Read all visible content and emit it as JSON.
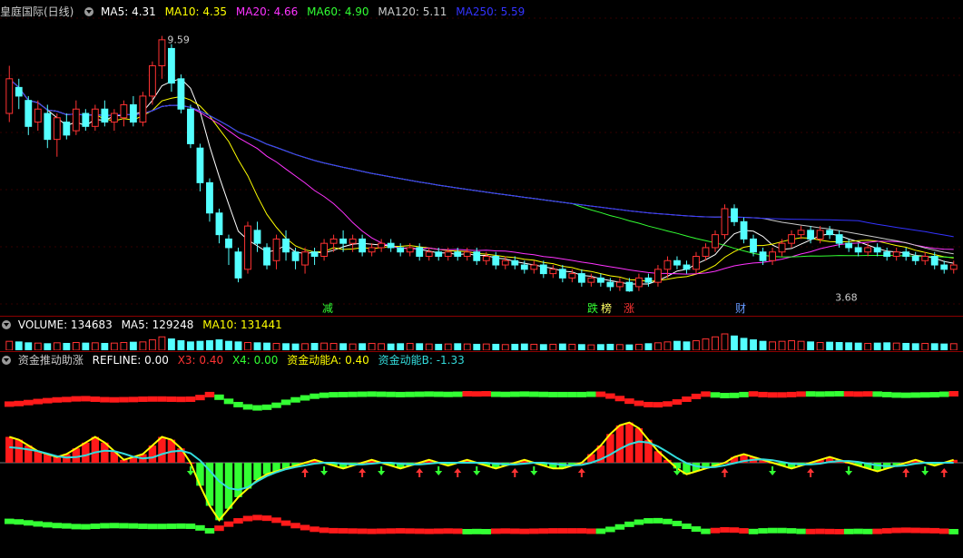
{
  "header": {
    "title": "皇庭国际(日线)",
    "indicators": [
      {
        "label": "MA5: 4.31",
        "color": "#ffffff"
      },
      {
        "label": "MA10: 4.35",
        "color": "#ffff00"
      },
      {
        "label": "MA20: 4.66",
        "color": "#ff33ff"
      },
      {
        "label": "MA60: 4.90",
        "color": "#33ff33"
      },
      {
        "label": "MA120: 5.11",
        "color": "#cccccc"
      },
      {
        "label": "MA250: 5.59",
        "color": "#3333ff"
      }
    ]
  },
  "volume_header": {
    "indicators": [
      {
        "label": "VOLUME: 134683",
        "color": "#ffffff"
      },
      {
        "label": "MA5: 129248",
        "color": "#ffffff"
      },
      {
        "label": "MA10: 131441",
        "color": "#ffff00"
      }
    ]
  },
  "fund_header": {
    "title": "资金推动助涨",
    "indicators": [
      {
        "label": "REFLINE: 0.00",
        "color": "#ffffff"
      },
      {
        "label": "X3: 0.40",
        "color": "#ff3333"
      },
      {
        "label": "X4: 0.00",
        "color": "#33ff33"
      },
      {
        "label": "资金动能A: 0.40",
        "color": "#ffff00"
      },
      {
        "label": "资金动能B: -1.33",
        "color": "#33dddd"
      }
    ]
  },
  "events": [
    {
      "label": "减",
      "color": "#33ff33"
    },
    {
      "label": "跌",
      "color": "#33ff33"
    },
    {
      "label": "榜",
      "color": "#ffff66"
    },
    {
      "label": "涨",
      "color": "#ff3333"
    },
    {
      "label": "财",
      "color": "#6699ff"
    }
  ],
  "chart_data": [
    {
      "type": "candlestick",
      "title": "皇庭国际(日线)",
      "annotations": [
        {
          "text": "9.59",
          "x": 16,
          "y": 9.59
        },
        {
          "text": "3.68",
          "x": 86,
          "y": 3.68
        }
      ],
      "ylim": [
        3.4,
        10.0
      ],
      "candles": [
        [
          0,
          7.8,
          8.6,
          7.6,
          8.9
        ],
        [
          1,
          8.4,
          8.2,
          7.9,
          8.6
        ],
        [
          2,
          8.1,
          7.5,
          7.3,
          8.2
        ],
        [
          3,
          7.6,
          7.9,
          7.4,
          8.1
        ],
        [
          4,
          7.8,
          7.2,
          7.0,
          8.0
        ],
        [
          5,
          7.2,
          7.7,
          6.8,
          7.8
        ],
        [
          6,
          7.6,
          7.3,
          7.2,
          7.8
        ],
        [
          7,
          7.4,
          7.9,
          7.3,
          8.1
        ],
        [
          8,
          7.8,
          7.5,
          7.4,
          7.9
        ],
        [
          9,
          7.5,
          7.9,
          7.4,
          8.0
        ],
        [
          10,
          7.9,
          7.6,
          7.5,
          8.1
        ],
        [
          11,
          7.6,
          7.8,
          7.4,
          7.9
        ],
        [
          12,
          7.7,
          8.0,
          7.5,
          8.1
        ],
        [
          13,
          8.0,
          7.6,
          7.5,
          8.2
        ],
        [
          14,
          7.6,
          8.2,
          7.5,
          8.3
        ],
        [
          15,
          8.2,
          8.9,
          8.0,
          9.0
        ],
        [
          16,
          8.9,
          9.5,
          8.6,
          9.59
        ],
        [
          17,
          9.3,
          8.5,
          8.3,
          9.4
        ],
        [
          18,
          8.6,
          7.9,
          7.8,
          8.7
        ],
        [
          19,
          7.9,
          7.1,
          7.0,
          8.0
        ],
        [
          20,
          7.0,
          6.2,
          6.0,
          7.1
        ],
        [
          21,
          6.2,
          5.5,
          5.3,
          6.3
        ],
        [
          22,
          5.5,
          5.0,
          4.8,
          5.6
        ],
        [
          23,
          4.9,
          4.7,
          4.3,
          5.0
        ],
        [
          24,
          4.6,
          4.0,
          3.9,
          4.7
        ],
        [
          25,
          4.2,
          5.2,
          4.1,
          5.3
        ],
        [
          26,
          5.1,
          4.8,
          4.6,
          5.3
        ],
        [
          27,
          4.7,
          4.3,
          4.2,
          4.8
        ],
        [
          28,
          4.4,
          4.9,
          4.2,
          5.0
        ],
        [
          29,
          4.9,
          4.6,
          4.4,
          5.1
        ],
        [
          30,
          4.6,
          4.4,
          4.2,
          4.7
        ],
        [
          31,
          4.3,
          4.6,
          4.1,
          4.7
        ],
        [
          32,
          4.6,
          4.5,
          4.3,
          4.7
        ],
        [
          33,
          4.5,
          4.8,
          4.4,
          4.9
        ],
        [
          34,
          4.8,
          4.9,
          4.6,
          5.0
        ],
        [
          35,
          4.9,
          4.8,
          4.6,
          5.1
        ],
        [
          36,
          4.8,
          4.9,
          4.6,
          5.0
        ],
        [
          37,
          4.9,
          4.6,
          4.5,
          5.0
        ],
        [
          38,
          4.6,
          4.7,
          4.5,
          4.8
        ],
        [
          39,
          4.7,
          4.8,
          4.6,
          4.9
        ],
        [
          40,
          4.8,
          4.7,
          4.6,
          4.9
        ],
        [
          41,
          4.7,
          4.6,
          4.5,
          4.8
        ],
        [
          42,
          4.6,
          4.7,
          4.5,
          4.8
        ],
        [
          43,
          4.7,
          4.5,
          4.4,
          4.8
        ],
        [
          44,
          4.5,
          4.6,
          4.4,
          4.7
        ],
        [
          45,
          4.6,
          4.5,
          4.4,
          4.7
        ],
        [
          46,
          4.5,
          4.6,
          4.4,
          4.7
        ],
        [
          47,
          4.6,
          4.5,
          4.4,
          4.7
        ],
        [
          48,
          4.5,
          4.6,
          4.4,
          4.7
        ],
        [
          49,
          4.6,
          4.4,
          4.3,
          4.7
        ],
        [
          50,
          4.4,
          4.5,
          4.3,
          4.6
        ],
        [
          51,
          4.5,
          4.3,
          4.2,
          4.6
        ],
        [
          52,
          4.3,
          4.4,
          4.2,
          4.5
        ],
        [
          53,
          4.4,
          4.3,
          4.2,
          4.5
        ],
        [
          54,
          4.3,
          4.2,
          4.1,
          4.4
        ],
        [
          55,
          4.2,
          4.3,
          4.1,
          4.4
        ],
        [
          56,
          4.3,
          4.1,
          4.0,
          4.4
        ],
        [
          57,
          4.1,
          4.2,
          4.0,
          4.3
        ],
        [
          58,
          4.2,
          4.0,
          3.9,
          4.3
        ],
        [
          59,
          4.0,
          4.1,
          3.9,
          4.2
        ],
        [
          60,
          4.1,
          3.9,
          3.8,
          4.2
        ],
        [
          61,
          3.9,
          4.0,
          3.8,
          4.1
        ],
        [
          62,
          4.0,
          3.9,
          3.8,
          4.1
        ],
        [
          63,
          3.9,
          3.8,
          3.7,
          4.0
        ],
        [
          64,
          3.8,
          3.9,
          3.7,
          4.0
        ],
        [
          65,
          3.9,
          3.7,
          3.68,
          4.0
        ],
        [
          66,
          3.8,
          4.0,
          3.7,
          4.1
        ],
        [
          67,
          4.0,
          3.9,
          3.8,
          4.1
        ],
        [
          68,
          3.9,
          4.2,
          3.8,
          4.3
        ],
        [
          69,
          4.2,
          4.4,
          4.0,
          4.5
        ],
        [
          70,
          4.4,
          4.3,
          4.2,
          4.5
        ],
        [
          71,
          4.3,
          4.2,
          4.1,
          4.4
        ],
        [
          72,
          4.2,
          4.5,
          4.1,
          4.6
        ],
        [
          73,
          4.5,
          4.7,
          4.4,
          4.8
        ],
        [
          74,
          4.7,
          5.0,
          4.6,
          5.1
        ],
        [
          75,
          5.0,
          5.6,
          4.9,
          5.7
        ],
        [
          76,
          5.6,
          5.3,
          5.2,
          5.7
        ],
        [
          77,
          5.3,
          4.9,
          4.8,
          5.4
        ],
        [
          78,
          4.9,
          4.6,
          4.5,
          5.0
        ],
        [
          79,
          4.6,
          4.4,
          4.3,
          4.7
        ],
        [
          80,
          4.4,
          4.6,
          4.3,
          4.7
        ],
        [
          81,
          4.6,
          4.8,
          4.5,
          4.9
        ],
        [
          82,
          4.8,
          5.0,
          4.7,
          5.1
        ],
        [
          83,
          5.0,
          5.1,
          4.9,
          5.2
        ],
        [
          84,
          5.1,
          4.9,
          4.8,
          5.2
        ],
        [
          85,
          4.9,
          5.1,
          4.8,
          5.2
        ],
        [
          86,
          5.1,
          5.0,
          4.9,
          5.2
        ],
        [
          87,
          5.0,
          4.8,
          4.7,
          5.1
        ],
        [
          88,
          4.8,
          4.7,
          4.6,
          4.9
        ],
        [
          89,
          4.7,
          4.6,
          4.5,
          4.8
        ],
        [
          90,
          4.6,
          4.7,
          4.5,
          4.8
        ],
        [
          91,
          4.7,
          4.6,
          4.5,
          4.8
        ],
        [
          92,
          4.6,
          4.5,
          4.4,
          4.7
        ],
        [
          93,
          4.5,
          4.6,
          4.4,
          4.7
        ],
        [
          94,
          4.6,
          4.5,
          4.4,
          4.7
        ],
        [
          95,
          4.5,
          4.4,
          4.3,
          4.6
        ],
        [
          96,
          4.4,
          4.5,
          4.3,
          4.6
        ],
        [
          97,
          4.5,
          4.3,
          4.2,
          4.6
        ],
        [
          98,
          4.3,
          4.2,
          4.1,
          4.4
        ],
        [
          99,
          4.2,
          4.3,
          4.1,
          4.4
        ]
      ],
      "series": [
        {
          "name": "MA5",
          "color": "#ffffff"
        },
        {
          "name": "MA10",
          "color": "#ffff00"
        },
        {
          "name": "MA20",
          "color": "#ff33ff"
        },
        {
          "name": "MA60",
          "color": "#33ff33"
        },
        {
          "name": "MA120",
          "color": "#cccccc"
        },
        {
          "name": "MA250",
          "color": "#3333ff"
        }
      ]
    },
    {
      "type": "bar",
      "title": "VOLUME",
      "values": [
        30,
        28,
        25,
        24,
        22,
        25,
        23,
        26,
        24,
        25,
        23,
        24,
        26,
        27,
        28,
        35,
        45,
        38,
        32,
        28,
        30,
        32,
        35,
        30,
        28,
        26,
        25,
        24,
        23,
        22,
        21,
        22,
        23,
        24,
        23,
        22,
        21,
        22,
        23,
        22,
        21,
        22,
        23,
        22,
        21,
        20,
        21,
        22,
        21,
        20,
        21,
        20,
        19,
        20,
        21,
        20,
        19,
        20,
        21,
        20,
        19,
        18,
        19,
        20,
        19,
        18,
        20,
        22,
        25,
        28,
        30,
        28,
        32,
        38,
        45,
        55,
        48,
        40,
        35,
        30,
        28,
        30,
        32,
        30,
        28,
        26,
        27,
        26,
        25,
        24,
        23,
        24,
        25,
        24,
        23,
        22,
        23,
        22,
        21,
        22
      ]
    },
    {
      "type": "bar",
      "title": "资金推动助涨",
      "ylim": [
        -3,
        3
      ],
      "values": [
        0.9,
        0.8,
        0.6,
        0.4,
        0.3,
        0.2,
        0.3,
        0.5,
        0.7,
        0.9,
        0.7,
        0.4,
        0.1,
        0.2,
        0.3,
        0.6,
        0.9,
        0.8,
        0.5,
        0.0,
        -0.8,
        -1.5,
        -2.0,
        -1.6,
        -1.2,
        -0.9,
        -0.6,
        -0.4,
        -0.3,
        -0.2,
        -0.1,
        0.0,
        0.1,
        0.0,
        -0.1,
        -0.2,
        -0.1,
        0.0,
        0.1,
        0.0,
        -0.1,
        -0.2,
        -0.1,
        0.0,
        0.1,
        0.0,
        -0.1,
        0.0,
        0.1,
        0.0,
        -0.1,
        -0.2,
        -0.1,
        0.0,
        0.1,
        0.0,
        -0.1,
        -0.2,
        -0.2,
        -0.1,
        0.0,
        0.3,
        0.6,
        1.0,
        1.3,
        1.4,
        1.2,
        0.8,
        0.4,
        0.1,
        -0.2,
        -0.4,
        -0.3,
        -0.2,
        -0.1,
        0.0,
        0.2,
        0.3,
        0.2,
        0.1,
        0.0,
        -0.1,
        -0.2,
        -0.1,
        0.0,
        0.1,
        0.2,
        0.1,
        0.0,
        -0.1,
        -0.2,
        -0.3,
        -0.2,
        -0.1,
        0.0,
        0.1,
        0.0,
        -0.1,
        0.0,
        0.1
      ]
    }
  ]
}
